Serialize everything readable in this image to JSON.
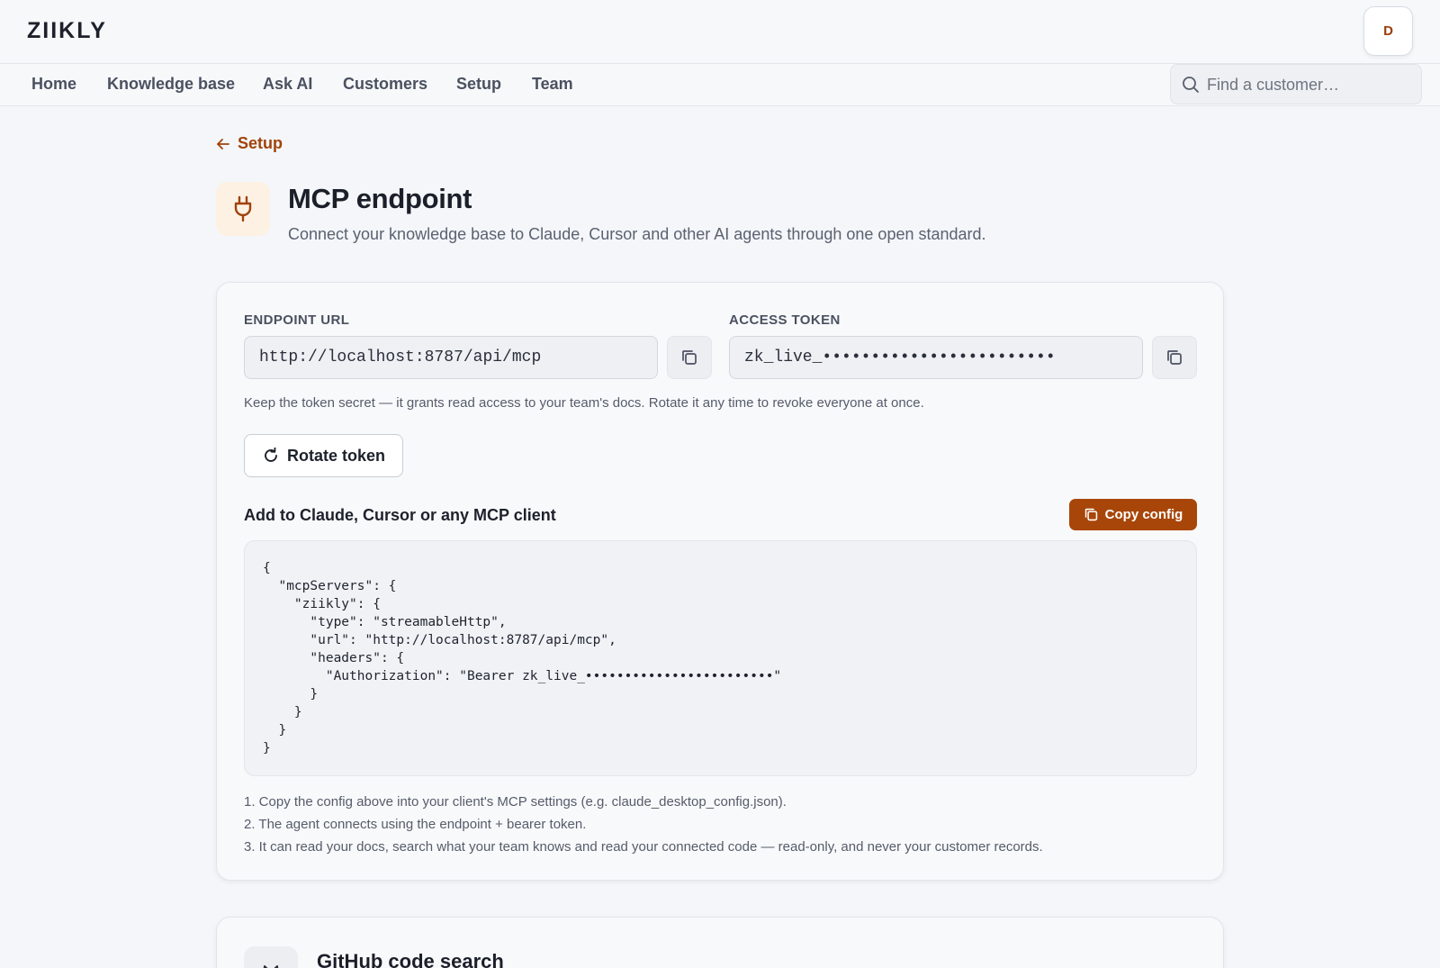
{
  "app": {
    "logo": "ZIIKLY",
    "avatar_initial": "D"
  },
  "nav": {
    "items": [
      {
        "label": "Home"
      },
      {
        "label": "Knowledge base"
      },
      {
        "label": "Ask AI"
      },
      {
        "label": "Customers"
      },
      {
        "label": "Setup"
      },
      {
        "label": "Team"
      }
    ],
    "search_placeholder": "Find a customer…"
  },
  "breadcrumb": {
    "back_label": "Setup"
  },
  "header": {
    "title": "MCP endpoint",
    "subtitle": "Connect your knowledge base to Claude, Cursor and other AI agents through one open standard.",
    "icon": "plug-icon"
  },
  "endpoint": {
    "url_label": "ENDPOINT URL",
    "url_value": "http://localhost:8787/api/mcp",
    "token_label": "ACCESS TOKEN",
    "token_value": "zk_live_••••••••••••••••••••••••",
    "helper": "Keep the token secret — it grants read access to your team's docs. Rotate it any time to revoke everyone at once.",
    "rotate_label": "Rotate token"
  },
  "config": {
    "title": "Add to Claude, Cursor or any MCP client",
    "copy_label": "Copy config",
    "code": "{\n  \"mcpServers\": {\n    \"ziikly\": {\n      \"type\": \"streamableHttp\",\n      \"url\": \"http://localhost:8787/api/mcp\",\n      \"headers\": {\n        \"Authorization\": \"Bearer zk_live_••••••••••••••••••••••••\"\n      }\n    }\n  }\n}",
    "steps": [
      "1. Copy the config above into your client's MCP settings (e.g. claude_desktop_config.json).",
      "2. The agent connects using the endpoint + bearer token.",
      "3. It can read your docs, search what your team knows and read your connected code — read-only, and never your customer records."
    ]
  },
  "github": {
    "title": "GitHub code search",
    "icon": "github-icon"
  },
  "colors": {
    "accent": "#a8460a",
    "accent_text": "#a0430b",
    "tile_bg": "#fdf1e4"
  }
}
